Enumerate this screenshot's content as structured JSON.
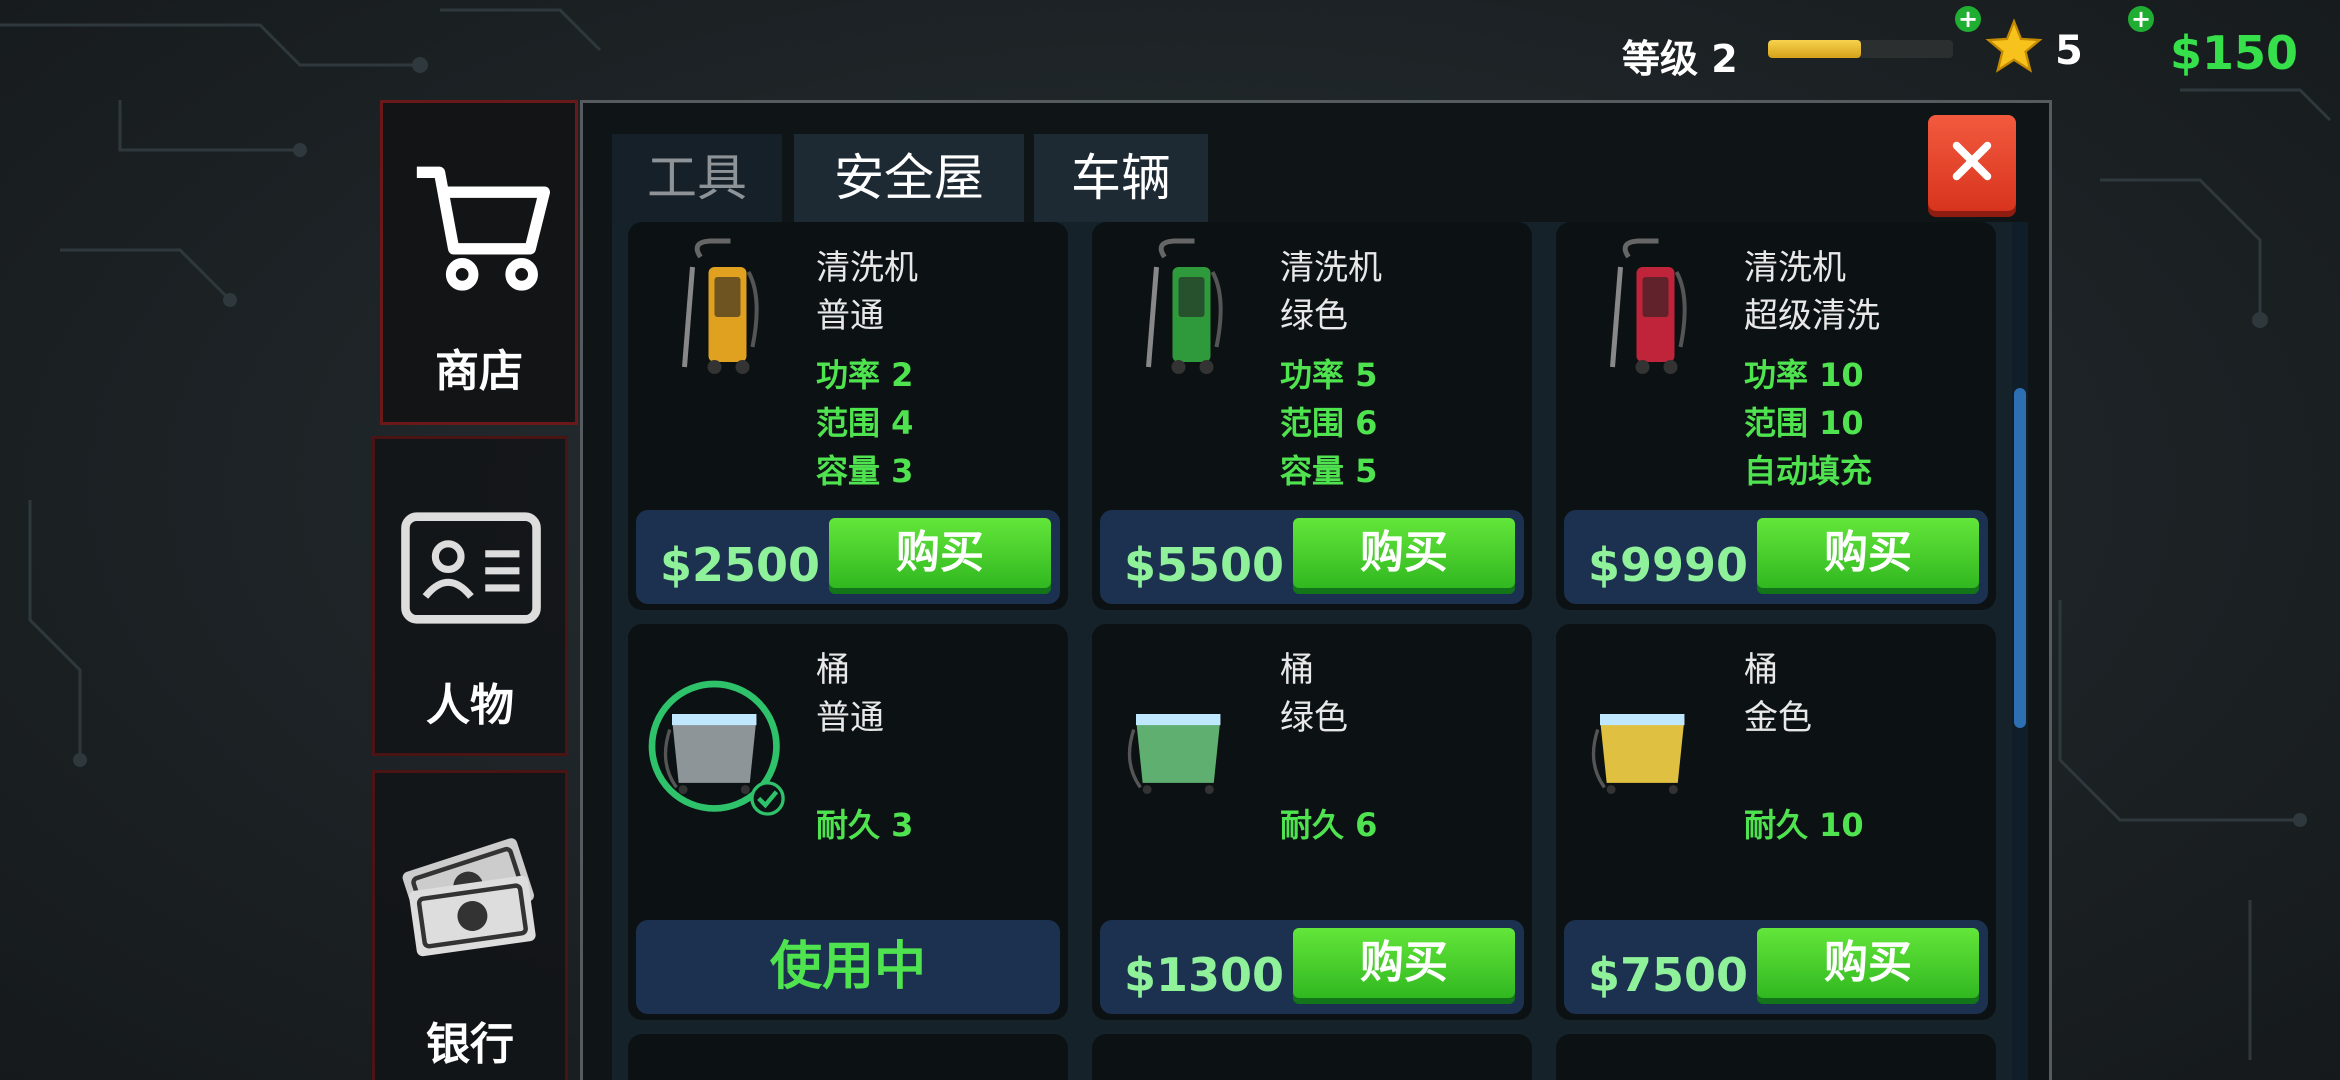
{
  "hud": {
    "level_label": "等级 2",
    "xp_fraction": 0.5,
    "stars": "5",
    "money": "$150",
    "accent_money_color": "#35e04b"
  },
  "nav": {
    "shop_label": "商店",
    "character_label": "人物",
    "bank_label": "银行"
  },
  "tabs": [
    {
      "label": "工具"
    },
    {
      "label": "安全屋"
    },
    {
      "label": "车辆"
    }
  ],
  "close_icon": "close-icon",
  "items": [
    {
      "name": "清洗机",
      "variant": "普通",
      "stats": [
        "功率 2",
        "范围 4",
        "容量 3"
      ],
      "price": "$2500",
      "button": "购买",
      "color": "#e0a020"
    },
    {
      "name": "清洗机",
      "variant": "绿色",
      "stats": [
        "功率 5",
        "范围 6",
        "容量 5"
      ],
      "price": "$5500",
      "button": "购买",
      "color": "#2f9a3c"
    },
    {
      "name": "清洗机",
      "variant": "超级清洗",
      "stats": [
        "功率 10",
        "范围 10",
        "自动填充"
      ],
      "price": "$9990",
      "button": "购买",
      "color": "#c0243a"
    },
    {
      "name": "桶",
      "variant": "普通",
      "stats": [
        "耐久 3"
      ],
      "status": "使用中",
      "color": "#8e9599"
    },
    {
      "name": "桶",
      "variant": "绿色",
      "stats": [
        "耐久 6"
      ],
      "price": "$1300",
      "button": "购买",
      "color": "#5fb070"
    },
    {
      "name": "桶",
      "variant": "金色",
      "stats": [
        "耐久 10"
      ],
      "price": "$7500",
      "button": "购买",
      "color": "#e0c040"
    }
  ]
}
